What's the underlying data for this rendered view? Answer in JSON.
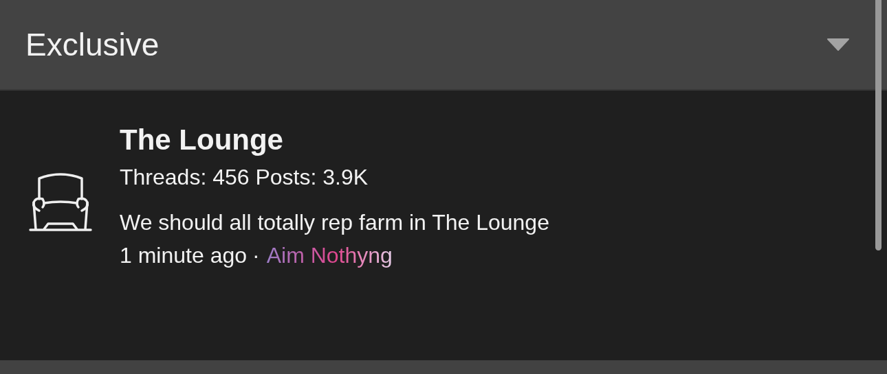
{
  "section": {
    "title": "Exclusive"
  },
  "forums": [
    {
      "title": "The Lounge",
      "stats": "Threads: 456 Posts: 3.9K",
      "latest_post": "We should all totally rep farm in The Lounge",
      "time": "1 minute ago",
      "separator": "·",
      "author": "Aim Nothyng"
    }
  ]
}
